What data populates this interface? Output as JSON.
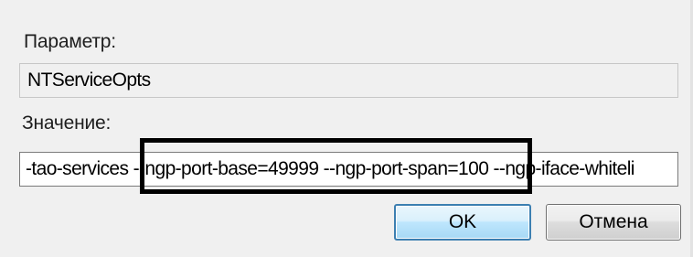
{
  "dialog": {
    "param_label": "Параметр:",
    "param_value": "NTServiceOpts",
    "value_label": "Значение:",
    "value_text": "-tao-services --ngp-port-base=49999 --ngp-port-span=100 --ngp-iface-whiteli",
    "ok_label": "OK",
    "cancel_label": "Отмена"
  },
  "colors": {
    "dialog_bg": "#f0f0f0",
    "highlight_border": "#000000",
    "ok_border": "#3c7fb1"
  }
}
